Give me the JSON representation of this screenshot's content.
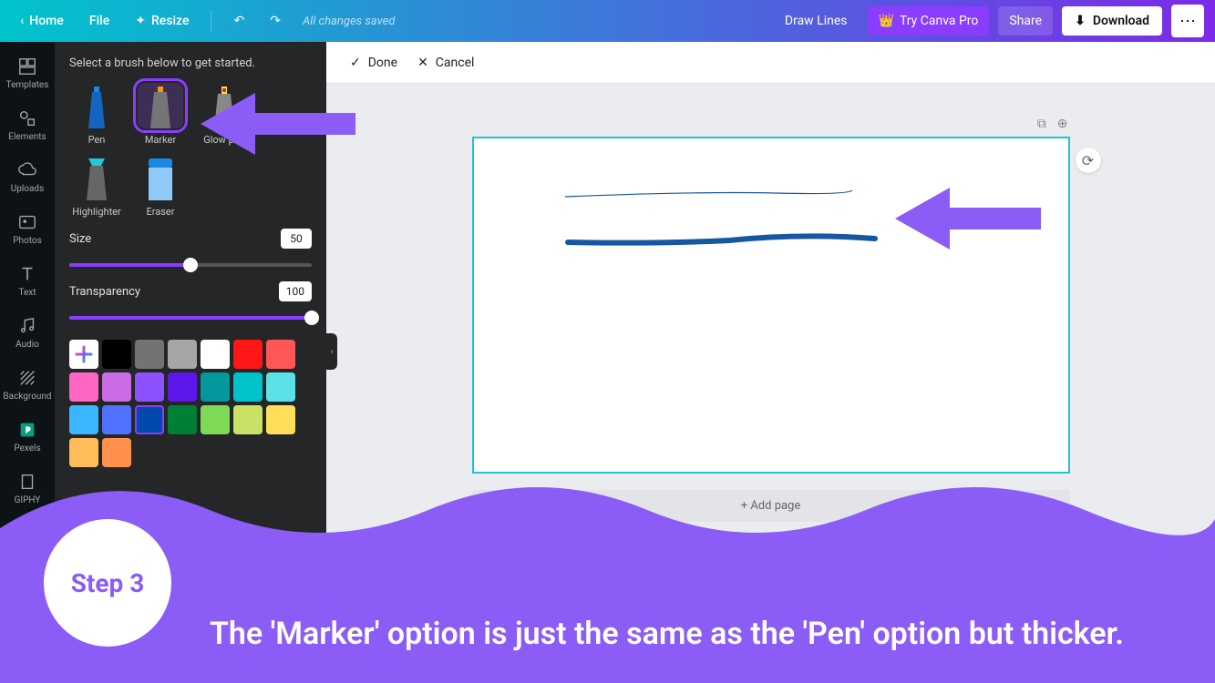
{
  "topbar": {
    "home": "Home",
    "file": "File",
    "resize": "Resize",
    "saved": "All changes saved",
    "doc_title": "Draw Lines",
    "try_pro": "Try Canva Pro",
    "share": "Share",
    "download": "Download"
  },
  "rail": {
    "templates": "Templates",
    "elements": "Elements",
    "uploads": "Uploads",
    "photos": "Photos",
    "text": "Text",
    "audio": "Audio",
    "background": "Background",
    "pexels": "Pexels",
    "giphy": "GIPHY"
  },
  "panel": {
    "title": "Select a brush below to get started.",
    "brushes": {
      "pen": "Pen",
      "marker": "Marker",
      "glow": "Glow pen",
      "highlighter": "Highlighter",
      "eraser": "Eraser"
    },
    "size_label": "Size",
    "size_value": "50",
    "transparency_label": "Transparency",
    "transparency_value": "100",
    "colors": {
      "black": "#000000",
      "grey": "#737373",
      "ltgrey": "#a6a6a6",
      "white": "#ffffff",
      "red": "#ff1616",
      "coral": "#ff5757",
      "pink": "#ff66c4",
      "violet": "#cb6ce6",
      "purple": "#8c52ff",
      "indigo": "#5e17eb",
      "teal": "#03989e",
      "cyan": "#00c2cb",
      "sky": "#5ce1e6",
      "blue": "#38b6ff",
      "azure": "#5271ff",
      "navy": "#004aad",
      "green": "#008037",
      "lime": "#7ed957",
      "chartreuse": "#c9e265",
      "yellow": "#ffde59",
      "gold": "#ffbd59",
      "orange": "#ff914d"
    }
  },
  "canvas": {
    "done": "Done",
    "cancel": "Cancel",
    "add_page": "+ Add page"
  },
  "annotation": {
    "step_label": "Step 3",
    "caption": "The 'Marker' option is just the same as the 'Pen' option but thicker."
  }
}
